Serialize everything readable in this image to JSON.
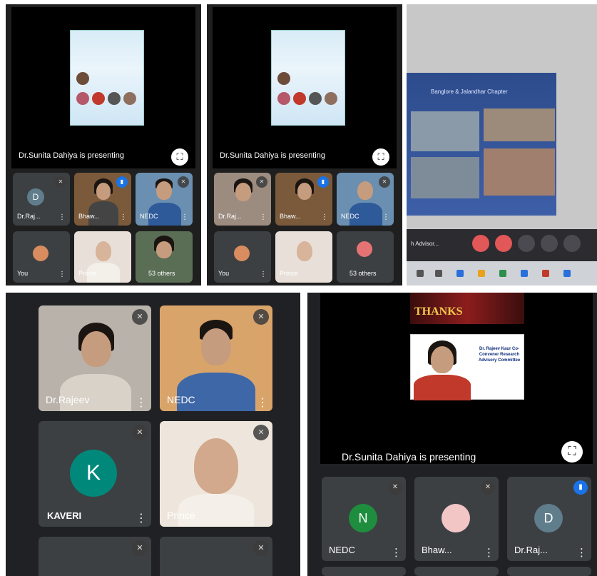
{
  "colors": {
    "meet_bg": "#202124",
    "tile_bg": "#3c4043",
    "speaking_blue": "#1a73e8",
    "avatar_green": "#1e8e3e",
    "avatar_teal": "#00897b",
    "avatar_slate": "#607d8b"
  },
  "shot1": {
    "presenting_text": "Dr.Sunita Dahiya is presenting",
    "fullscreen_icon": "fullscreen-icon",
    "tiles": [
      {
        "name": "Dr.Raj...",
        "initial": "D",
        "mic": "mic-off-icon"
      },
      {
        "name": "Bhaw...",
        "mic": "speaking-icon"
      },
      {
        "name": "NEDC",
        "mic": "mic-off-icon"
      },
      {
        "name": "You"
      },
      {
        "name": "Prince"
      },
      {
        "name": "53 others"
      }
    ]
  },
  "shot2": {
    "presenting_text": "Dr.Sunita Dahiya is presenting",
    "tiles": [
      {
        "name": "Dr.Raj...",
        "mic": "mic-off-icon"
      },
      {
        "name": "Bhaw...",
        "mic": "speaking-icon"
      },
      {
        "name": "NEDC",
        "mic": "mic-off-icon"
      },
      {
        "name": "You"
      },
      {
        "name": "Prince"
      },
      {
        "name": "53 others"
      }
    ]
  },
  "shot3": {
    "slide_title": "Banglore & Jalandhar Chapter",
    "caption": "h Advisor..."
  },
  "shot4": {
    "tiles": [
      {
        "name": "Dr.Rajeev",
        "mic": "mic-off-icon"
      },
      {
        "name": "NEDC",
        "mic": "mic-off-icon"
      },
      {
        "name": "KAVERI",
        "initial": "K",
        "mic": "mic-off-icon"
      },
      {
        "name": "Prince",
        "mic": "mic-off-icon"
      }
    ]
  },
  "shot5": {
    "banner_text": "THANKS",
    "card_lines": "Dr. Rajeev Kaur  Co-Convener Research Advisory Committee",
    "presenting_text": "Dr.Sunita Dahiya is presenting",
    "tiles": [
      {
        "name": "NEDC",
        "initial": "N",
        "mic": "mic-off-icon"
      },
      {
        "name": "Bhaw...",
        "mic": "mic-off-icon"
      },
      {
        "name": "Dr.Raj...",
        "initial": "D",
        "mic": "speaking-icon"
      }
    ]
  }
}
